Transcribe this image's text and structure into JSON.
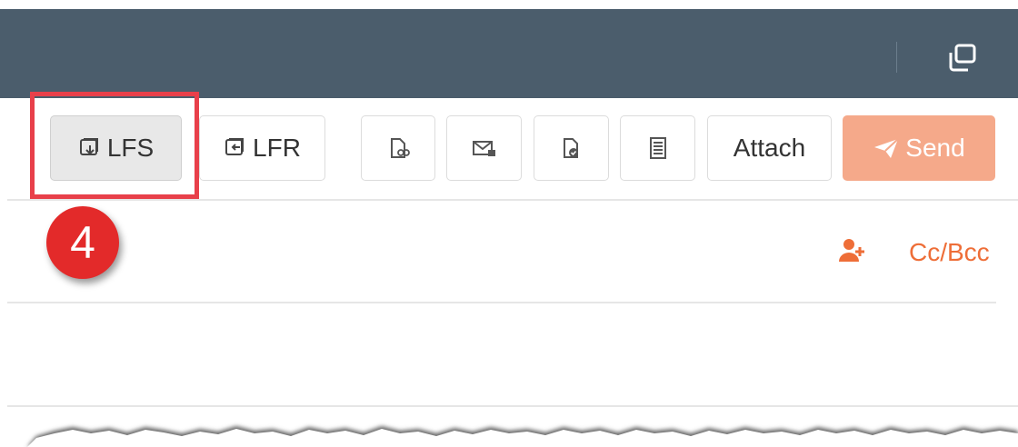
{
  "header": {
    "restore_icon": "window-restore-icon",
    "color": "#4b5d6c"
  },
  "toolbar": {
    "lfs_label": "LFS",
    "lfr_label": "LFR",
    "attach_label": "Attach",
    "send_label": "Send",
    "send_color": "#f5a98a",
    "icons": {
      "lfs": "file-save-icon",
      "lfr": "file-reply-icon",
      "doc_link": "document-link-icon",
      "secure_mail": "secure-mail-icon",
      "doc_check": "document-check-icon",
      "template": "template-icon",
      "send": "paper-plane-icon"
    }
  },
  "annotation": {
    "step_number": "4",
    "highlight_color": "#e8404a"
  },
  "recipients": {
    "cc_bcc_label": "Cc/Bcc",
    "add_recipient_icon": "add-person-icon",
    "accent_color": "#ee6e38"
  }
}
